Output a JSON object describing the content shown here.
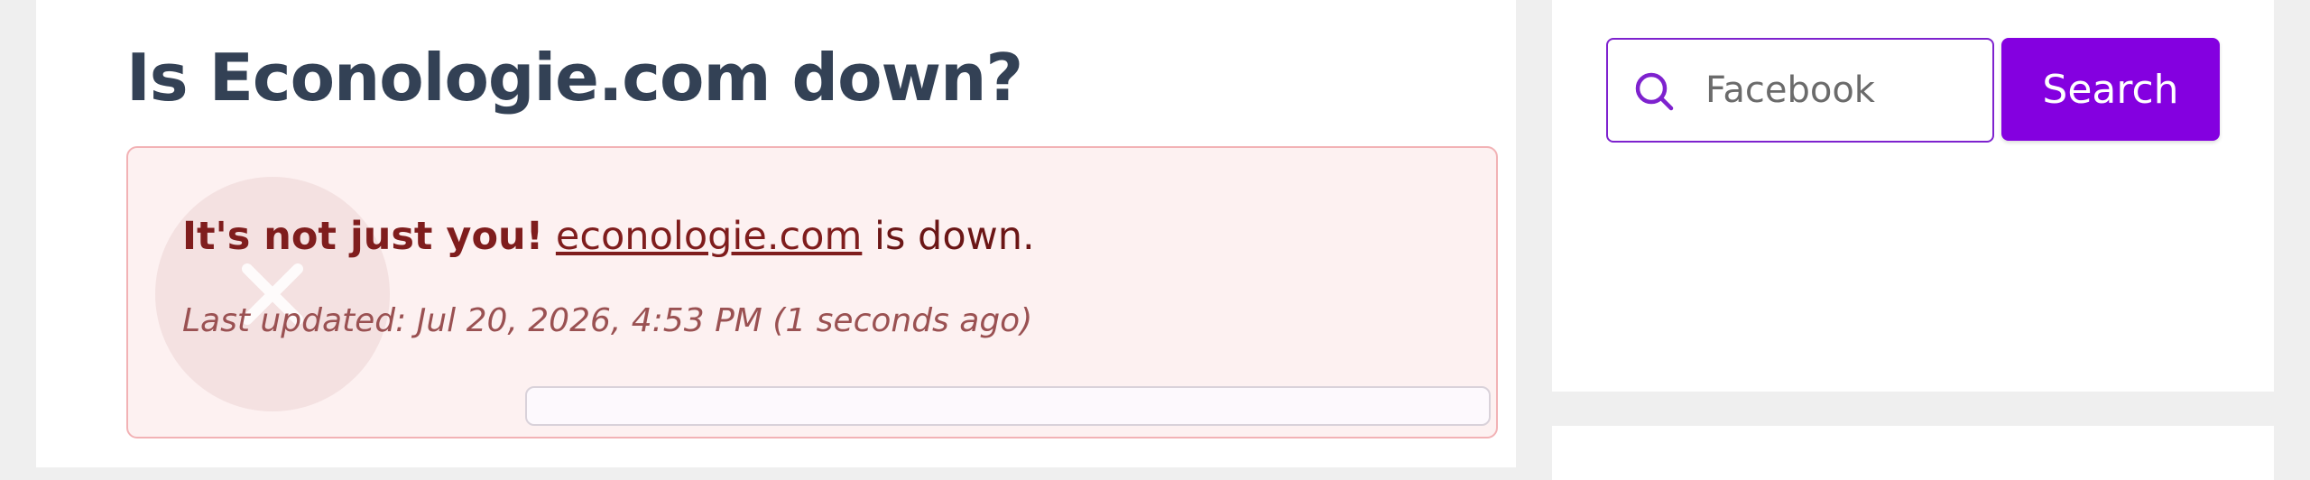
{
  "page": {
    "title": "Is Econologie.com down?"
  },
  "status": {
    "headline": "It's not just you!",
    "domain": "econologie.com",
    "suffix": "is down.",
    "last_updated": "Last updated: Jul 20, 2026, 4:53 PM (1 seconds ago)",
    "state_icon": "close-x-icon",
    "colors": {
      "alert_bg": "#fdf1f1",
      "alert_border": "#f2b2b5",
      "text": "#7f1d1d"
    }
  },
  "sidebar": {
    "search": {
      "placeholder": "Facebook",
      "icon": "search-icon",
      "button_label": "Search",
      "accent_color": "#8400e0"
    }
  }
}
